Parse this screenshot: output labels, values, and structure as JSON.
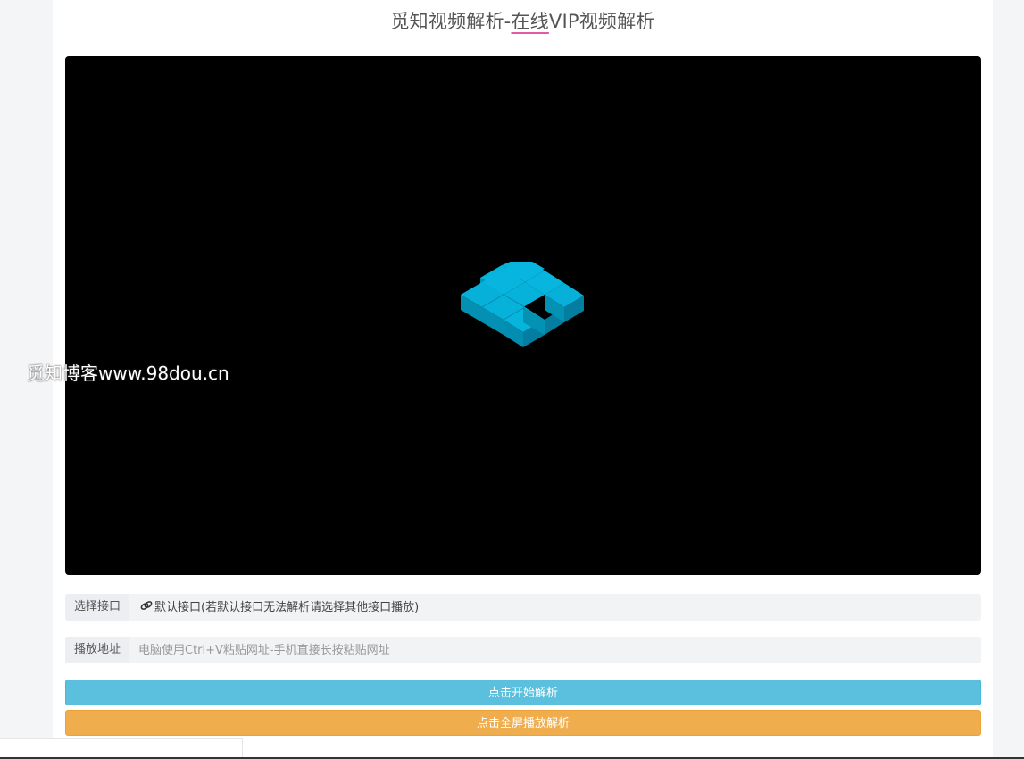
{
  "header": {
    "title_prefix": "觅知视频解析-",
    "title_underlined": "在线",
    "title_suffix": "VIP视频解析"
  },
  "player": {
    "loader_icon": "isometric-cubes-loader-icon",
    "loader_color": "#00aed6"
  },
  "watermark": {
    "text": "觅知博客www.98dou.cn"
  },
  "form": {
    "interface_label": "选择接口",
    "interface_icon": "link-icon",
    "interface_value": "默认接口(若默认接口无法解析请选择其他接口播放)",
    "url_label": "播放地址",
    "url_placeholder": "电脑使用Ctrl+V粘贴网址-手机直接长按粘贴网址"
  },
  "buttons": {
    "parse_label": "点击开始解析",
    "fullscreen_label": "点击全屏播放解析"
  },
  "colors": {
    "parse_button": "#5bc0de",
    "fullscreen_button": "#f0ad4e",
    "title_underline": "#e05aa5"
  }
}
